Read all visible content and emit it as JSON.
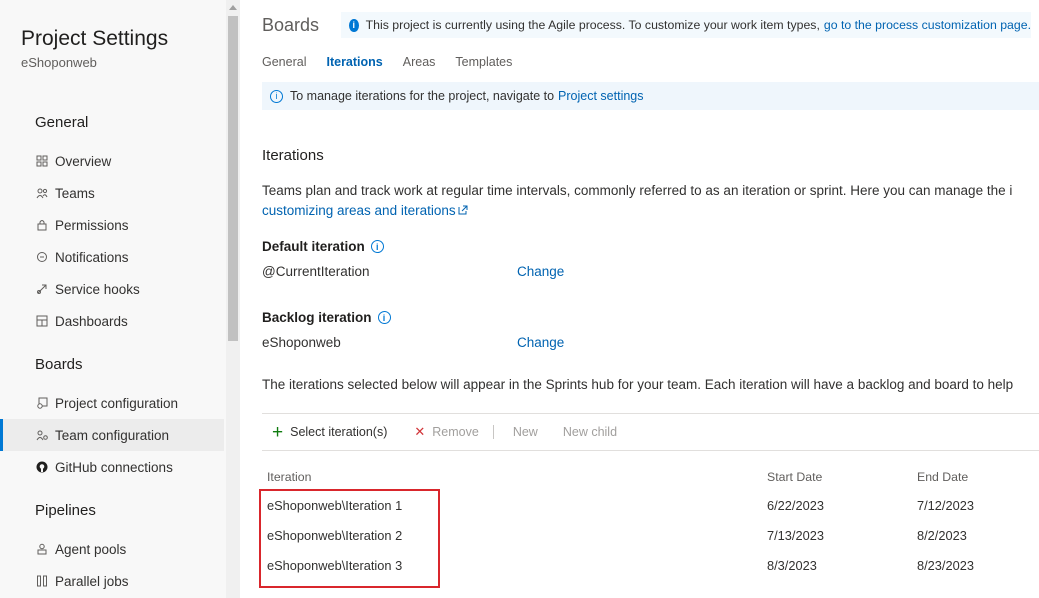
{
  "sidebar": {
    "title": "Project Settings",
    "project": "eShoponweb",
    "sections": [
      {
        "heading": "General"
      },
      {
        "heading": "Boards"
      },
      {
        "heading": "Pipelines"
      }
    ],
    "items": [
      {
        "label": "Overview",
        "icon": "overview-icon"
      },
      {
        "label": "Teams",
        "icon": "teams-icon"
      },
      {
        "label": "Permissions",
        "icon": "lock-icon"
      },
      {
        "label": "Notifications",
        "icon": "chat-icon"
      },
      {
        "label": "Service hooks",
        "icon": "hook-icon"
      },
      {
        "label": "Dashboards",
        "icon": "dashboard-icon"
      },
      {
        "label": "Project configuration",
        "icon": "project-config-icon"
      },
      {
        "label": "Team configuration",
        "icon": "team-config-icon",
        "selected": true
      },
      {
        "label": "GitHub connections",
        "icon": "github-icon"
      },
      {
        "label": "Agent pools",
        "icon": "agent-pool-icon"
      },
      {
        "label": "Parallel jobs",
        "icon": "parallel-jobs-icon"
      }
    ]
  },
  "header": {
    "title": "Boards",
    "banner_text": "This project is currently using the Agile process. To customize your work item types, ",
    "banner_link": "go to the process customization page."
  },
  "tabs": [
    {
      "label": "General"
    },
    {
      "label": "Iterations",
      "active": true
    },
    {
      "label": "Areas"
    },
    {
      "label": "Templates"
    }
  ],
  "manage_banner": {
    "text": "To manage iterations for the project, navigate to ",
    "link": "Project settings"
  },
  "iterations": {
    "title": "Iterations",
    "description": "Teams plan and track work at regular time intervals, commonly referred to as an iteration or sprint. Here you can manage the i",
    "description_link": "customizing areas and iterations",
    "default_label": "Default iteration",
    "default_value": "@CurrentIteration",
    "backlog_label": "Backlog iteration",
    "backlog_value": "eShoponweb",
    "change_label": "Change",
    "sprints_text": "The iterations selected below will appear in the Sprints hub for your team. Each iteration will have a backlog and board to help"
  },
  "toolbar": {
    "select": "Select iteration(s)",
    "remove": "Remove",
    "new": "New",
    "new_child": "New child"
  },
  "table": {
    "headers": [
      "Iteration",
      "Start Date",
      "End Date"
    ],
    "rows": [
      {
        "iteration": "eShoponweb\\Iteration 1",
        "start": "6/22/2023",
        "end": "7/12/2023"
      },
      {
        "iteration": "eShoponweb\\Iteration 2",
        "start": "7/13/2023",
        "end": "8/2/2023"
      },
      {
        "iteration": "eShoponweb\\Iteration 3",
        "start": "8/3/2023",
        "end": "8/23/2023"
      }
    ]
  },
  "colors": {
    "accent": "#0078d4",
    "link": "#0063b1",
    "highlight": "#d9262c",
    "add": "#107c10"
  }
}
